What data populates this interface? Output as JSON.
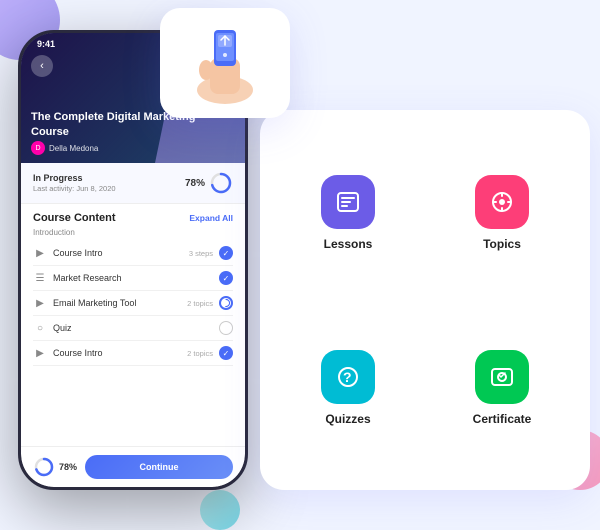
{
  "status_bar": {
    "time": "9:41",
    "icons": "▲ ◼ ▮▮▮"
  },
  "course": {
    "title": "The Complete Digital Marketing Course",
    "author": "Della Medona",
    "progress_pct": "78%",
    "progress_label": "In Progress",
    "last_activity": "Last activity: Jun 8, 2020",
    "content_title": "Course Content",
    "expand_all": "Expand All",
    "section_intro": "Introduction",
    "items": [
      {
        "icon": "▶",
        "name": "Course Intro",
        "meta": "3 steps",
        "status": "done"
      },
      {
        "icon": "☰",
        "name": "Market Research",
        "meta": "",
        "status": "done"
      },
      {
        "icon": "▶",
        "name": "Email Marketing Tool",
        "meta": "2 topics",
        "status": "partial"
      },
      {
        "icon": "○",
        "name": "Quiz",
        "meta": "",
        "status": "empty"
      },
      {
        "icon": "▶",
        "name": "Course Intro",
        "meta": "2 topics",
        "status": "done"
      }
    ],
    "bottom_pct": "78%",
    "continue_label": "Continue"
  },
  "features": [
    {
      "id": "lessons",
      "label": "Lessons",
      "icon_class": "icon-lessons"
    },
    {
      "id": "topics",
      "label": "Topics",
      "icon_class": "icon-topics"
    },
    {
      "id": "quizzes",
      "label": "Quizzes",
      "icon_class": "icon-quizzes"
    },
    {
      "id": "certificate",
      "label": "Certificate",
      "icon_class": "icon-certificate"
    }
  ]
}
